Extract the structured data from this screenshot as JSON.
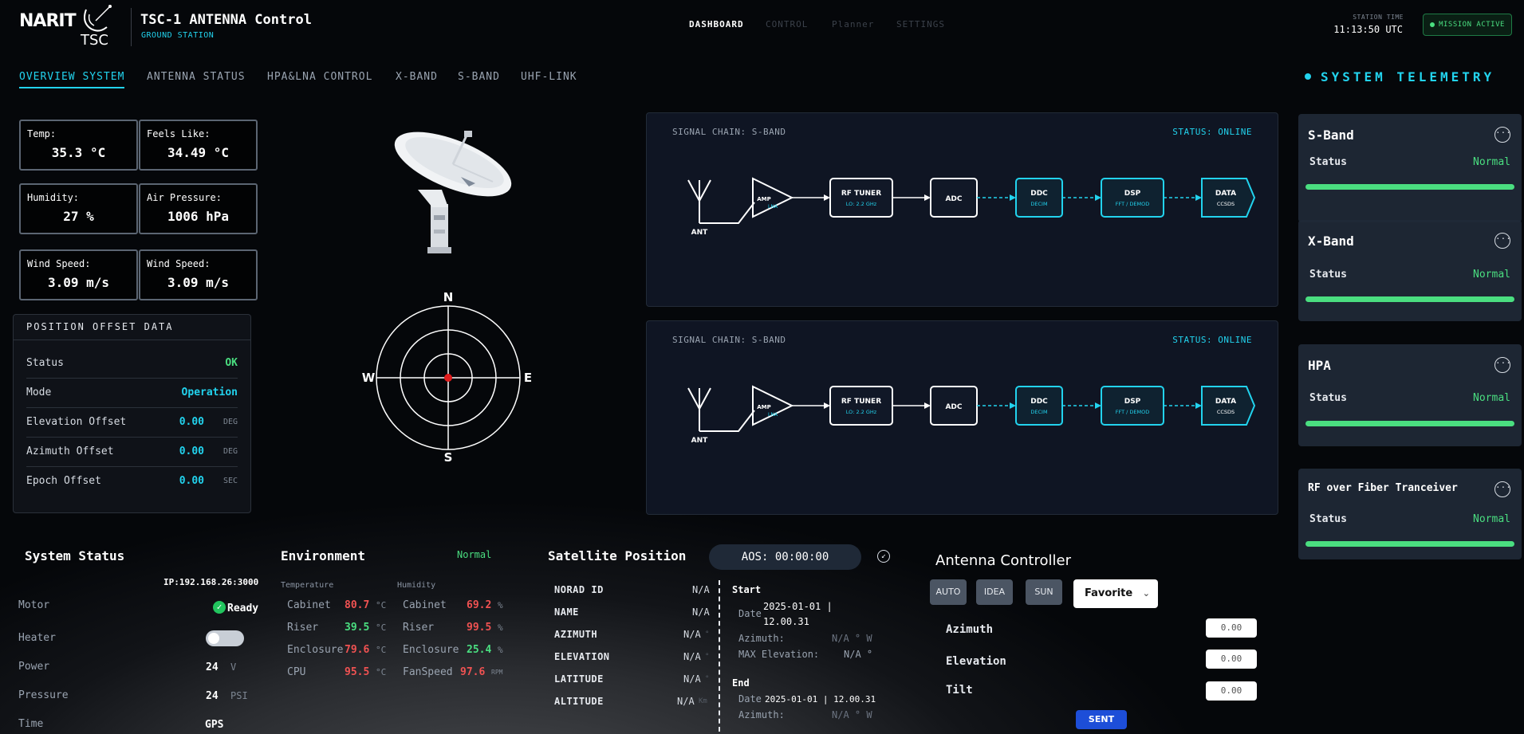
{
  "header": {
    "logo_narit": "NARIT",
    "logo_tsc": "TSC",
    "title": "TSC-1 ANTENNA Control",
    "subtitle": "GROUND STATION",
    "nav": [
      "DASHBOARD",
      "CONTROL",
      "Planner",
      "SETTINGS"
    ],
    "station_time_label": "STATION TIME",
    "station_time": "11:13:50 UTC",
    "mission_status": "MISSION ACTIVE"
  },
  "tabs": [
    "OVERVIEW SYSTEM",
    "ANTENNA STATUS",
    "HPA&LNA CONTROL",
    "X-BAND",
    "S-BAND",
    "UHF-LINK"
  ],
  "telemetry_title": "SYSTEM TELEMETRY",
  "weather": [
    {
      "label": "Temp:",
      "value": "35.3 °C"
    },
    {
      "label": "Feels Like:",
      "value": "34.49 °C"
    },
    {
      "label": "Humidity:",
      "value": "27 %"
    },
    {
      "label": "Air Pressure:",
      "value": "1006 hPa"
    },
    {
      "label": "Wind Speed:",
      "value": "3.09 m/s"
    },
    {
      "label": "Wind Speed:",
      "value": "3.09 m/s"
    }
  ],
  "position_offset": {
    "title": "POSITION OFFSET DATA",
    "rows": [
      {
        "label": "Status",
        "value": "OK",
        "unit": ""
      },
      {
        "label": "Mode",
        "value": "Operation",
        "unit": ""
      },
      {
        "label": "Elevation Offset",
        "value": "0.00",
        "unit": "DEG"
      },
      {
        "label": "Azimuth Offset",
        "value": "0.00",
        "unit": "DEG"
      },
      {
        "label": "Epoch Offset",
        "value": "0.00",
        "unit": "SEC"
      }
    ]
  },
  "compass": {
    "n": "N",
    "s": "S",
    "e": "E",
    "w": "W"
  },
  "signal_chains": [
    {
      "title": "SIGNAL CHAIN: S-BAND",
      "status": "STATUS: ONLINE"
    },
    {
      "title": "SIGNAL CHAIN: S-BAND",
      "status": "STATUS: ONLINE"
    }
  ],
  "chain_blocks": {
    "ant": "ANT",
    "amp": "AMP",
    "amp_sub": "LNA",
    "tuner": "RF TUNER",
    "tuner_sub": "LO: 2.2 GHz",
    "adc": "ADC",
    "ddc": "DDC",
    "ddc_sub": "DECIM",
    "dsp": "DSP",
    "dsp_sub": "FFT / DEMOD",
    "data": "DATA",
    "data_sub": "CCSDS"
  },
  "telemetry_cards": [
    {
      "name": "S-Band",
      "status_label": "Status",
      "status": "Normal",
      "level": 1.0
    },
    {
      "name": "X-Band",
      "status_label": "Status",
      "status": "Normal",
      "level": 1.0
    },
    {
      "name": "HPA",
      "status_label": "Status",
      "status": "Normal",
      "level": 1.0
    },
    {
      "name": "RF over Fiber Tranceiver",
      "status_label": "Status",
      "status": "Normal",
      "level": 1.0
    }
  ],
  "system_status": {
    "title": "System Status",
    "ip": "IP:192.168.26:3000",
    "motor_label": "Motor",
    "motor_value": "Ready",
    "heater_label": "Heater",
    "power_label": "Power",
    "power_value": "24",
    "power_unit": "V",
    "pressure_label": "Pressure",
    "pressure_value": "24",
    "pressure_unit": "PSI",
    "time_label": "Time",
    "time_value": "GPS"
  },
  "environment": {
    "title": "Environment",
    "status": "Normal",
    "temp_header": "Temperature",
    "hum_header": "Humidity",
    "temperature": [
      {
        "label": "Cabinet",
        "value": "80.7",
        "unit": "°C"
      },
      {
        "label": "Riser",
        "value": "39.5",
        "unit": "°C"
      },
      {
        "label": "Enclosure",
        "value": "79.6",
        "unit": "°C"
      },
      {
        "label": "CPU",
        "value": "95.5",
        "unit": "°C"
      }
    ],
    "humidity": [
      {
        "label": "Cabinet",
        "value": "69.2",
        "unit": "%"
      },
      {
        "label": "Riser",
        "value": "99.5",
        "unit": "%"
      },
      {
        "label": "Enclosure",
        "value": "25.4",
        "unit": "%"
      },
      {
        "label": "FanSpeed",
        "value": "97.6",
        "unit": "RPM"
      }
    ]
  },
  "satellite": {
    "title": "Satellite Position",
    "aos": "AOS: 00:00:00",
    "rows": [
      {
        "label": "NORAD ID",
        "value": "N/A",
        "unit": ""
      },
      {
        "label": "NAME",
        "value": "N/A",
        "unit": ""
      },
      {
        "label": "AZIMUTH",
        "value": "N/A",
        "unit": "°"
      },
      {
        "label": "ELEVATION",
        "value": "N/A",
        "unit": "°"
      },
      {
        "label": "LATITUDE",
        "value": "N/A",
        "unit": "°"
      },
      {
        "label": "ALTITUDE",
        "value": "N/A",
        "unit": "Km"
      }
    ],
    "start_label": "Start",
    "start_date_label": "Date",
    "start_date": "2025-01-01 |",
    "start_time": "12.00.31",
    "start_az_label": "Azimuth:",
    "start_az": "N/A ° W",
    "max_el_label": "MAX Elevation:",
    "max_el": "N/A °",
    "end_label": "End",
    "end_date_label": "Date",
    "end_date": "2025-01-01 | 12.00.31",
    "end_az_label": "Azimuth:",
    "end_az": "N/A ° W"
  },
  "antenna_controller": {
    "title": "Antenna Controller",
    "buttons": [
      "AUTO",
      "IDEA",
      "SUN"
    ],
    "favorite": "Favorite",
    "rows": [
      {
        "label": "Azimuth",
        "value": "0.00"
      },
      {
        "label": "Elevation",
        "value": "0.00"
      },
      {
        "label": "Tilt",
        "value": "0.00"
      }
    ],
    "send": "SENT"
  },
  "colors": {
    "accent": "#22d3ee",
    "ok": "#4ade80",
    "alert": "#f05252",
    "panel": "#111827"
  }
}
